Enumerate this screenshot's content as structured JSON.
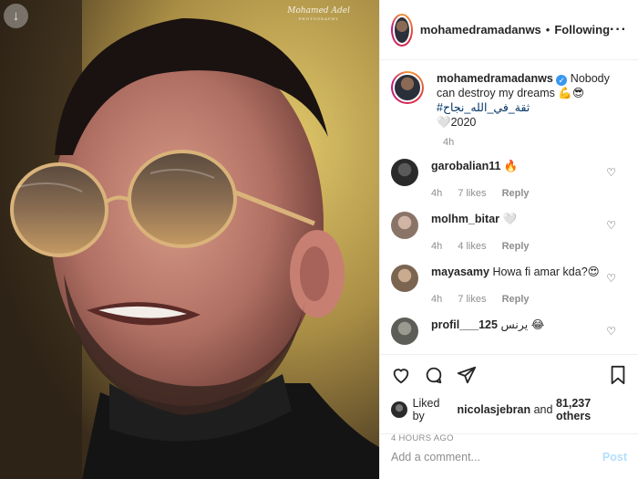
{
  "photo": {
    "download_icon": "arrow-down-icon",
    "watermark": "Mohamed Adel",
    "watermark_sub": "PHOTOGRAPHY"
  },
  "header": {
    "username": "mohamedramadanws",
    "separator": "•",
    "follow_status": "Following",
    "more_icon": "ellipsis-icon"
  },
  "caption": {
    "username": "mohamedramadanws",
    "text": "Nobody can destroy my dreams 💪😎",
    "hashtags": "#ثقة_في_الله_نجاح",
    "year_line": "🤍2020",
    "time": "4h"
  },
  "comments": [
    {
      "username": "garobalian11",
      "text": "🔥",
      "time": "4h",
      "likes": "7 likes",
      "reply": "Reply",
      "avatar_color": "#3a3a3a"
    },
    {
      "username": "molhm_bitar",
      "text": "🤍",
      "time": "4h",
      "likes": "4 likes",
      "reply": "Reply",
      "avatar_color": "#b59a8a"
    },
    {
      "username": "mayasamy",
      "text": "Howa fi amar kda?😍",
      "time": "4h",
      "likes": "7 likes",
      "reply": "Reply",
      "avatar_color": "#a08770"
    },
    {
      "username": "profil___125",
      "text": "يرنس 😂",
      "time": "",
      "likes": "",
      "reply": "",
      "avatar_color": "#7f8078"
    }
  ],
  "actions": {
    "like_icon": "heart-icon",
    "comment_icon": "comment-icon",
    "share_icon": "paper-plane-icon",
    "save_icon": "bookmark-icon",
    "liked_prefix": "Liked by",
    "liked_user": "nicolasjebran",
    "liked_and": "and",
    "liked_count": "81,237 others",
    "posted_ago": "4 HOURS AGO"
  },
  "add_comment": {
    "placeholder": "Add a comment...",
    "post_label": "Post"
  },
  "colors": {
    "link_blue": "#3897f0",
    "post_disabled": "#b2dffc",
    "muted": "#8e8e8e",
    "border": "#efefef"
  }
}
